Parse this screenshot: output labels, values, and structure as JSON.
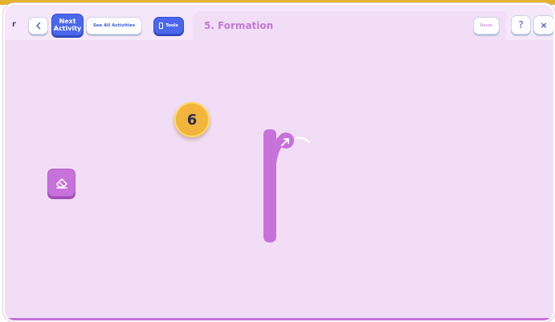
{
  "toolbar": {
    "prefix_text": "r",
    "back_icon": "chevron-left-icon",
    "next_activity_label_line1": "Next",
    "next_activity_label_line2": "Activity",
    "see_all_label": "See All Activities",
    "tools_label": "Tools",
    "tools_icon": "phone-icon",
    "title": "5. Formation",
    "reset_label": "Reset",
    "help_label": "?",
    "close_label": "×"
  },
  "canvas": {
    "step_badge": "6",
    "eraser_icon": "eraser-icon",
    "letter_icon": "letter-r-trace-icon"
  },
  "colors": {
    "accent_purple": "#c771db",
    "accent_blue": "#4a67ee",
    "badge_yellow": "#f2b53c",
    "background": "#f2ddf7",
    "top_strip": "#e4b22f"
  }
}
